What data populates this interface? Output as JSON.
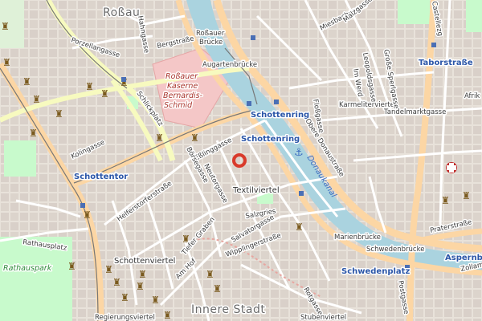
{
  "map": {
    "districts": {
      "rossau": "Roßau",
      "textilviertel": "Textilviertel",
      "schottenviertel": "Schottenviertel",
      "innere_stadt": "Innere Stadt"
    },
    "water": {
      "canal": "Donaukanal"
    },
    "landmarks": {
      "barracks": "Roßauer Kaserne Bernardis-Schmid",
      "barracks_line1": "Roßauer",
      "barracks_line2": "Kaserne",
      "barracks_line3": "Bernardis-",
      "barracks_line4": "Schmid",
      "park": "Rathauspark"
    },
    "stations": {
      "schottenring": "Schottenring",
      "schottentor": "Schottentor",
      "schwedenplatz": "Schwedenplatz",
      "taborstrasse": "Taborstraße"
    },
    "streets": {
      "porzellangasse": "Porzellangasse",
      "bergstrasse": "Bergstraße",
      "hahngasse": "Hahngasse",
      "rossauer_bruecke_1": "Roßauer",
      "rossauer_bruecke_2": "Brücke",
      "augartenbruecke": "Augartenbrücke",
      "schlickplatz": "Schlickplatz",
      "kolingasse": "Kolingasse",
      "obere_donaustrasse": "Obere Donaustraße",
      "esslinggasse": "Eßlinggasse",
      "boersegasse": "Börsegasse",
      "neutorgasse": "Neutorgasse",
      "helferstorferstrasse": "Helferstorferstraße",
      "salzgries": "Salzgries",
      "salvatorgasse": "Salvatorgasse",
      "wipplingerstrasse": "Wipplingerstraße",
      "tiefer_graben": "Tiefer Graben",
      "am_hof": "Am Hof",
      "rotgasse": "Rotgasse",
      "marienbruecke": "Marienbrücke",
      "schwedenbruecke": "Schwedenbrücke",
      "stubenviertel": "Stubenviertel",
      "karmeliterviertel": "Karmeliterviertel",
      "im_werd": "Im Werd",
      "tandelmarktgasse": "Tandelmarktgasse",
      "praterstrasse": "Praterstraße",
      "aspernbruecke": "Aspernbr",
      "floßgasse": "Floßgasse",
      "rathausplatz": "Rathausplatz",
      "regierungsviertel": "Regierungsviertel",
      "afrika": "Afrik",
      "castellezgasse": "Castellezg",
      "miesbachgasse": "Miesbachgasse",
      "malzgasse": "Malzgasse",
      "leopoldsgasse": "Leopoldsgasse",
      "grosse_sperlgasse": "Große Sperlgasse",
      "postgasse": "Postgasse",
      "zollamtsstrasse": "Zollamtsstraße"
    },
    "colors": {
      "background": "#f2efe9",
      "water": "#aad3df",
      "primary_road": "#fcd6a4",
      "secondary_road": "#f7fabf",
      "park": "#c8facc",
      "military": "#f4c7c7",
      "marker": "#d93a2b",
      "station_text": "#2b56a8"
    },
    "icons": [
      "castle-icon",
      "anchor-icon",
      "hospital-icon",
      "location-marker-icon",
      "tram-stop-icon"
    ]
  }
}
